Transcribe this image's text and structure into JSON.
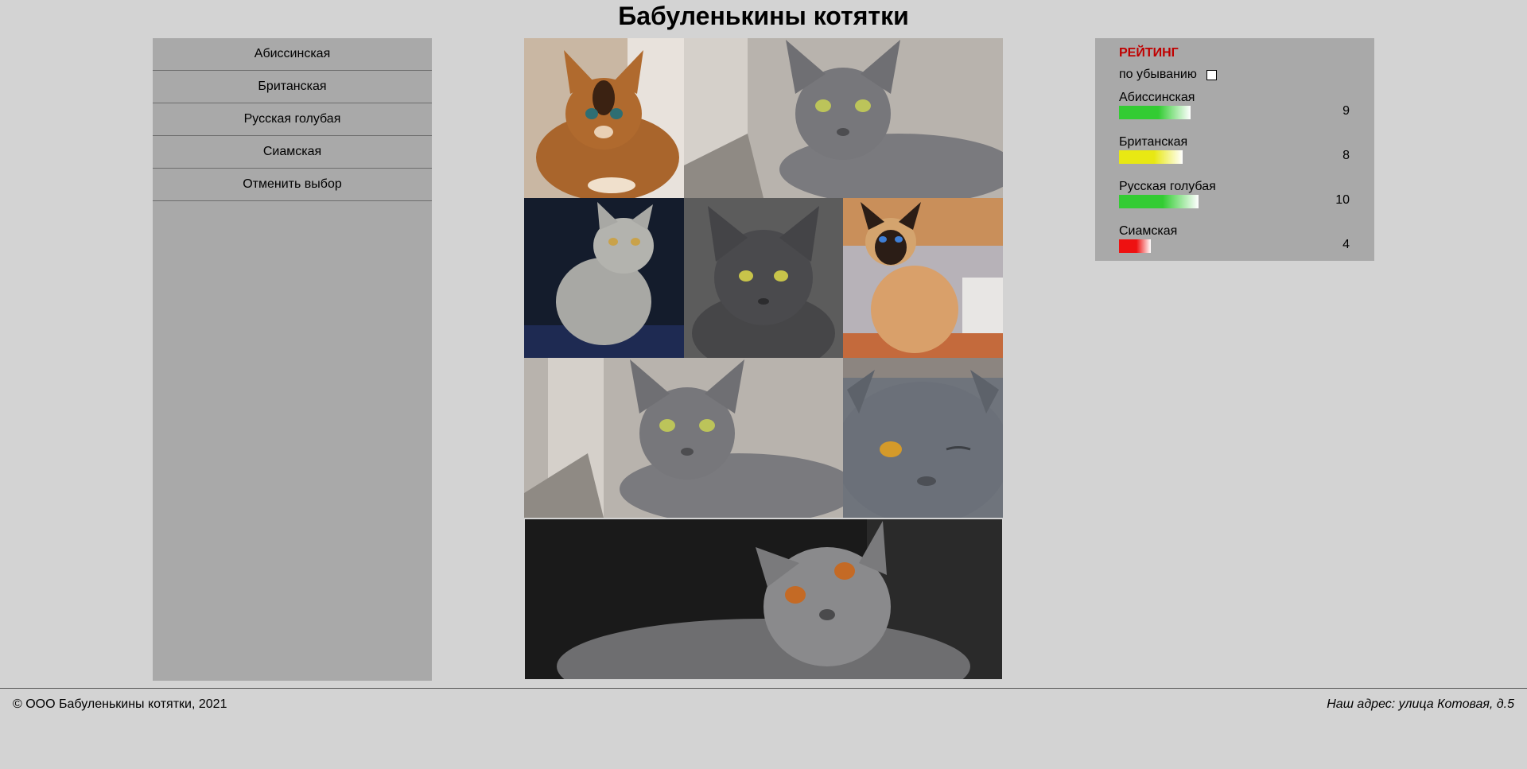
{
  "header": {
    "title": "Бабуленькины котятки"
  },
  "menu": {
    "items": [
      {
        "label": "Абиссинская"
      },
      {
        "label": "Британская"
      },
      {
        "label": "Русская голубая"
      },
      {
        "label": "Сиамская"
      },
      {
        "label": "Отменить выбор"
      }
    ]
  },
  "rating": {
    "title": "РЕЙТИНГ",
    "sort_label": "по убыванию",
    "sort_checked": false,
    "max_value": 10,
    "items": [
      {
        "name": "Абиссинская",
        "value": 9,
        "color": "#33cc33"
      },
      {
        "name": "Британская",
        "value": 8,
        "color": "#e8e813"
      },
      {
        "name": "Русская голубая",
        "value": 10,
        "color": "#33cc33"
      },
      {
        "name": "Сиамская",
        "value": 4,
        "color": "#ee1111"
      }
    ]
  },
  "footer": {
    "copyright": "© ООО Бабуленькины котятки, 2021",
    "address": "Наш адрес: улица Котовая, д.5"
  }
}
